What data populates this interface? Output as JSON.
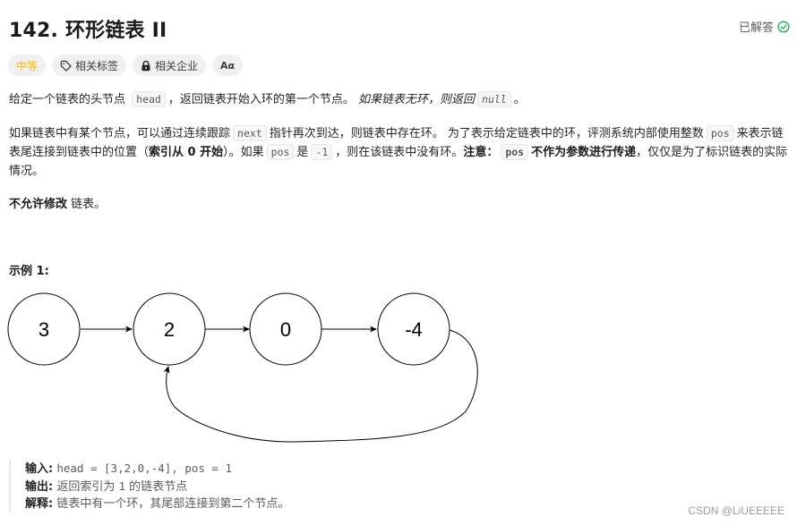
{
  "header": {
    "title": "142. 环形链表 II",
    "solved_label": "已解答",
    "solved_color": "#2db55d"
  },
  "tags": {
    "difficulty": "中等",
    "difficulty_color": "#ffb800",
    "related_tags": "相关标签",
    "related_companies": "相关企业",
    "font_toggle": "Aα"
  },
  "description": {
    "p1": {
      "t1": "给定一个链表的头节点",
      "code1": "head",
      "t2": "，返回链表开始入环的第一个节点。",
      "italic": "如果链表无环，则返回",
      "code2": "null",
      "t3": "。"
    },
    "p2": {
      "t1": "如果链表中有某个节点，可以通过连续跟踪",
      "code1": "next",
      "t2": "指针再次到达，则链表中存在环。 为了表示给定链表中的环，评测系统内部使用整数",
      "code2": "pos",
      "t3": "来表示链表尾连接到链表中的位置（",
      "bold1": "索引从 0 开始",
      "t4": "）。如果",
      "code3": "pos",
      "t5": "是",
      "code4": "-1",
      "t6": "，则在该链表中没有环。",
      "bold2": "注意：",
      "code5": "pos",
      "bold3": "不作为参数进行传递",
      "t7": "，仅仅是为了标识链表的实际情况。"
    },
    "p3": {
      "bold": "不允许修改",
      "t1": "链表。"
    }
  },
  "example": {
    "heading": "示例 1:",
    "nodes": [
      "3",
      "2",
      "0",
      "-4"
    ],
    "cycle_target_index": 1,
    "input_label": "输入:",
    "input_value": "head = [3,2,0,-4], pos = 1",
    "output_label": "输出:",
    "output_t1": "返回索引为",
    "output_code": "1",
    "output_t2": "的链表节点",
    "explain_label": "解释:",
    "explain_value": "链表中有一个环，其尾部连接到第二个节点。"
  },
  "watermark": "CSDN @LiUEEEEE"
}
